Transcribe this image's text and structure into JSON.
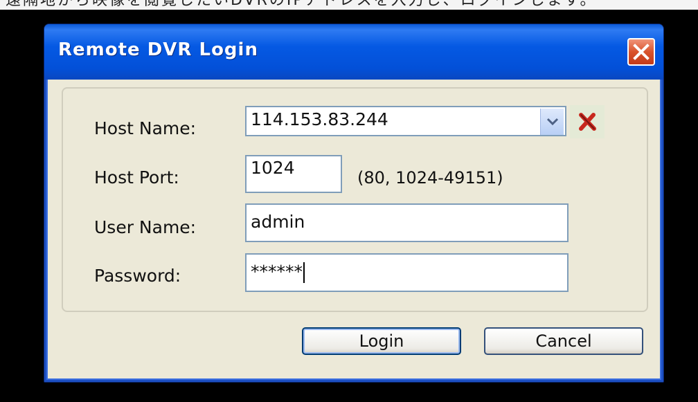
{
  "background_text": "遠隔地から映像を閲覧したいDVRのIPアドレスを入力し、ログインします。",
  "dialog": {
    "title": "Remote DVR Login",
    "close_icon": "close-icon"
  },
  "form": {
    "host_name_label": "Host Name:",
    "host_name_value": "114.153.83.244",
    "host_port_label": "Host Port:",
    "host_port_value": "1024",
    "host_port_hint": "(80, 1024-49151)",
    "user_name_label": "User Name:",
    "user_name_value": "admin",
    "password_label": "Password:",
    "password_value": "******"
  },
  "buttons": {
    "login": "Login",
    "cancel": "Cancel"
  },
  "colors": {
    "titlebar": "#0559e3",
    "dialog_bg": "#ece9d8",
    "close_button": "#d9532c",
    "clear_icon": "#c8281e"
  }
}
